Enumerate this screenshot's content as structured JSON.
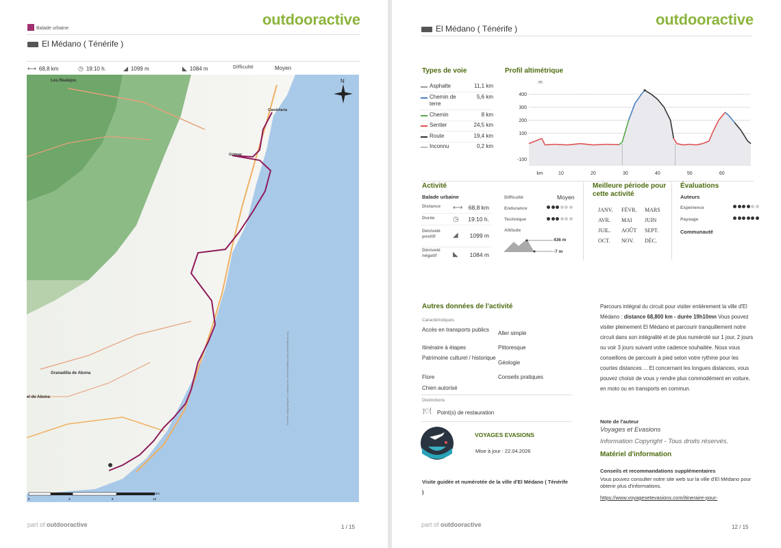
{
  "brand": "outdooractive",
  "page1": {
    "category": "Balade urbaine",
    "title": "El Médano ( Ténérife )",
    "stats": {
      "distance": "68,8 km",
      "duration": "19:10 h.",
      "ascent": "1099 m",
      "descent": "1084 m",
      "difficulty_label": "Difficulté",
      "difficulty": "Moyen"
    },
    "map_labels": [
      "Los Realejos",
      "Candelaria",
      "Güímar",
      "Granadilla de Abona",
      "el de Abona"
    ],
    "map_credit": "Données cartographiques © outdooractive, OpenStreetMap (www.openstreetmap.org)",
    "scale": [
      "0",
      "3",
      "6",
      "9",
      "12",
      "km"
    ],
    "footer_part": "part of",
    "footer_brand": "outdooractive",
    "page_num": "1 / 15"
  },
  "page2": {
    "title": "El Médano ( Ténérife )",
    "types_title": "Types de voie",
    "types": [
      {
        "name": "Asphalte",
        "value": "11,1 km",
        "color": "#999999"
      },
      {
        "name": "Chemin de terre",
        "value": "5,6 km",
        "color": "#4a7fc1"
      },
      {
        "name": "Chemin",
        "value": "8 km",
        "color": "#55aa44"
      },
      {
        "name": "Sentier",
        "value": "24,5 km",
        "color": "#e05050"
      },
      {
        "name": "Route",
        "value": "19,4 km",
        "color": "#333333"
      },
      {
        "name": "Inconnu",
        "value": "0,2 km",
        "color": "#bbbbbb"
      }
    ],
    "profile_title": "Profil altimétrique",
    "profile_unit": "m",
    "profile_yticks": [
      "400",
      "300",
      "200",
      "100",
      "-100"
    ],
    "profile_xticks": [
      "km",
      "10",
      "20",
      "30",
      "40",
      "50",
      "60"
    ],
    "activity_title": "Activité",
    "activity_type": "Balade urbaine",
    "activity_rows": [
      {
        "label": "Distance",
        "icon": "⟷",
        "value": "68,8 km"
      },
      {
        "label": "Durée",
        "icon": "◷",
        "value": "19:10 h."
      },
      {
        "label": "Dénivelé positif",
        "icon": "◢",
        "value": "1099 m"
      },
      {
        "label": "Dénivelé négatif",
        "icon": "◣",
        "value": "1084 m"
      }
    ],
    "difficulty_label": "Difficulté",
    "difficulty_value": "Moyen",
    "endurance_label": "Endurance",
    "endurance": 3,
    "technique_label": "Technique",
    "technique": 3,
    "altitude_label": "Altitude",
    "alt_max": "436 m",
    "alt_min": "-7 m",
    "best_period_title": "Meilleure période pour cette activité",
    "months": [
      "JANV.",
      "FÉVR.",
      "MARS",
      "AVR.",
      "MAI",
      "JUIN",
      "JUIL.",
      "AOÛT",
      "SEPT.",
      "OCT.",
      "NOV.",
      "DÉC."
    ],
    "eval_title": "Évaluations",
    "eval_authors": "Auteurs",
    "experience_label": "Expérience",
    "experience": 4,
    "landscape_label": "Paysage",
    "landscape": 6,
    "community": "Communauté",
    "other_title": "Autres données de l'activité",
    "characteristics_label": "Caractéristiques",
    "features_left": [
      "Accès en transports publics",
      "Itinéraire à étapes",
      "Patrimoine culturel / historique",
      "Flore",
      "Chien autorisé"
    ],
    "features_right": [
      "Aller simple",
      "Pittoresque",
      "Géologie",
      "Conseils pratiques"
    ],
    "distinctions_label": "Distinctions",
    "restaurant": "Point(s) de restauration",
    "author_name": "VOYAGES EVASIONS",
    "updated": "Mise à jour : 22.04.2026",
    "guided": "Visite guidée et numérotée de la ville d'El Médano ( Ténérife )",
    "para_part1": "Parcours intégral du circuit pour visiter entièrement la ville d'El Médano : ",
    "para_bold": "distance 68,800 km - durée 19h10mn",
    "para_part2": " Vous pouvez visiter pleinement El Médano et parcourir tranquillement notre circuit dans son intégralité et de plus numéroté sur 1 jour, 2 jours ou voir 3 jours suivant votre cadence souhaitée. Nous vous conseillons de parcourir à pied selon votre rythme pour les courtes distances ... Et concernant les longues distances, vous pouvez choisir de vous y rendre plus commodément en voiture, en moto ou en transports en commun.",
    "author_note": "Note de l'auteur",
    "author_italic": "Voyages et Evasions",
    "copyright": "Information Copyright - Tous droits réservés.",
    "material_title": "Matériel d'information",
    "tips_title": "Conseils et recommandations supplémentaires",
    "tips_text": "Vous pouvez consulter notre site web sur la ville d'El Médano pour obtenir plus d'informations.",
    "link": "https://www.voyagesetevasions.com/itineraire-pour-",
    "footer_part": "part of",
    "footer_brand": "outdooractive",
    "page_num": "12 / 15"
  }
}
